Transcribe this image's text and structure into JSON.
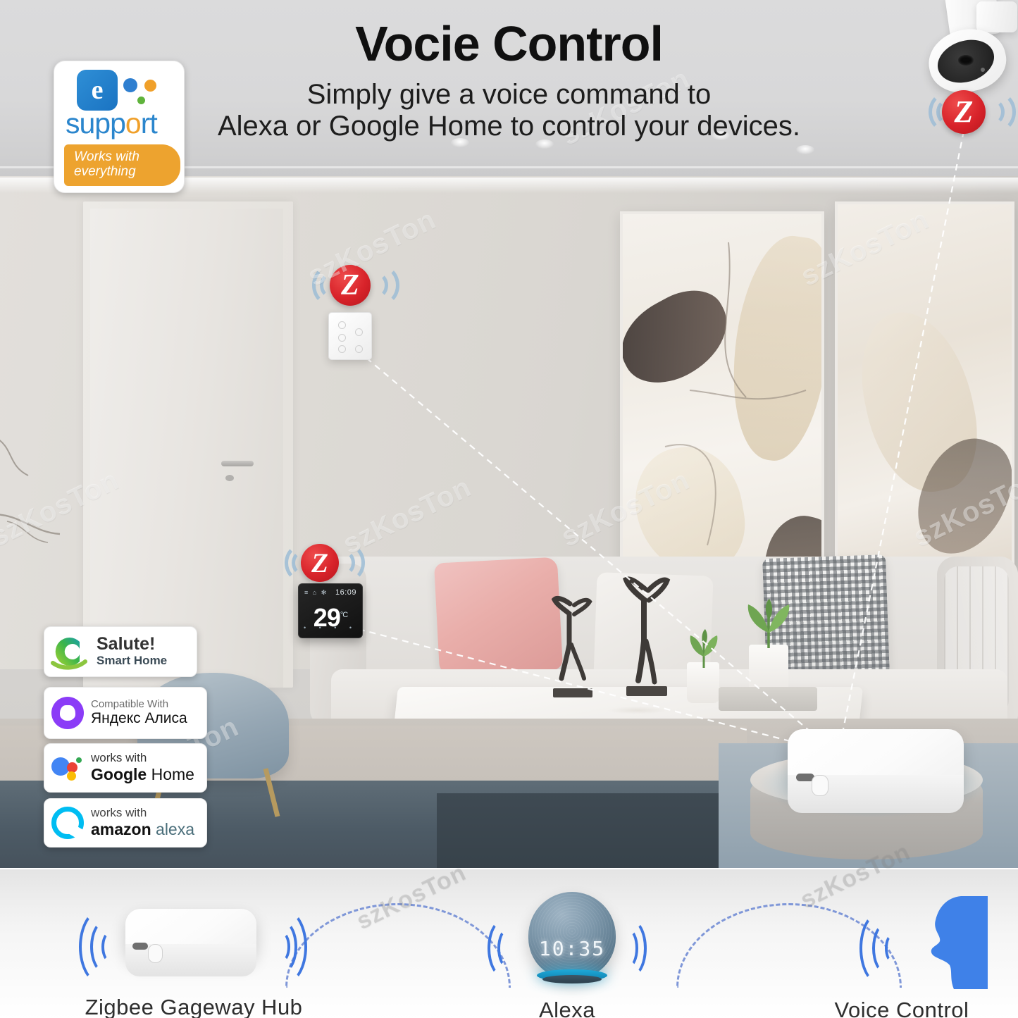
{
  "header": {
    "title": "Vocie Control",
    "subtitle_line1": "Simply give a voice command to",
    "subtitle_line2": "Alexa or Google Home to control your devices."
  },
  "watermark": {
    "text": "szKosTon"
  },
  "esupport_badge": {
    "icon": "ewelink-e-icon",
    "brand_e": "e",
    "word_part1": "supp",
    "word_o": "o",
    "word_part2": "rt",
    "tagline_line1": "Works with",
    "tagline_line2": "everything",
    "blue": "#2b86cd",
    "orange": "#eda32f"
  },
  "compat_badges": [
    {
      "name": "salute-smart-home",
      "icon": "salute-swirl-icon",
      "line1": "Salute!",
      "line2": "Smart Home"
    },
    {
      "name": "yandex-alice",
      "icon": "alice-circle-icon",
      "line1": "Compatible With",
      "line2": "Яндекс Алиса",
      "color": "#8b3cf7"
    },
    {
      "name": "google-home",
      "icon": "google-assistant-dots-icon",
      "line1": "works with",
      "line2_bold": "Google",
      "line2_rest": " Home"
    },
    {
      "name": "amazon-alexa",
      "icon": "alexa-ring-icon",
      "line1": "works with",
      "line2_bold": "amazon",
      "line2_rest": " alexa",
      "color": "#00bdf2"
    }
  ],
  "zigbee_badges": [
    {
      "name": "zigbee-badge-camera",
      "letter": "Z",
      "color": "#d8232a"
    },
    {
      "name": "zigbee-badge-switch",
      "letter": "Z",
      "color": "#d8232a"
    },
    {
      "name": "zigbee-badge-thermostat",
      "letter": "Z",
      "color": "#d8232a"
    }
  ],
  "devices": {
    "camera": {
      "name": "ceiling-security-camera"
    },
    "wall_switch": {
      "name": "smart-wall-switch-panel",
      "buttons": 6
    },
    "thermostat": {
      "name": "smart-thermostat-panel",
      "time": "16:09",
      "temperature": "29",
      "unit": "°C",
      "mode_icons": "≡ ⌂ ✻",
      "bottom_icons": "• • • •"
    },
    "gateway_room": {
      "name": "zigbee-gateway-hub-on-ottoman"
    }
  },
  "banner": {
    "items": [
      {
        "name": "zigbee-gateway-hub",
        "label": "Zigbee Gageway Hub",
        "icon": "hub-device-icon"
      },
      {
        "name": "alexa-echo-dot",
        "label": "Alexa",
        "icon": "echo-dot-icon",
        "clock": "10:35"
      },
      {
        "name": "voice-control",
        "label": "Voice Control",
        "icon": "speaking-head-icon"
      }
    ],
    "arc_color": "#7f97d8",
    "wave_color": "#3f77e0"
  }
}
